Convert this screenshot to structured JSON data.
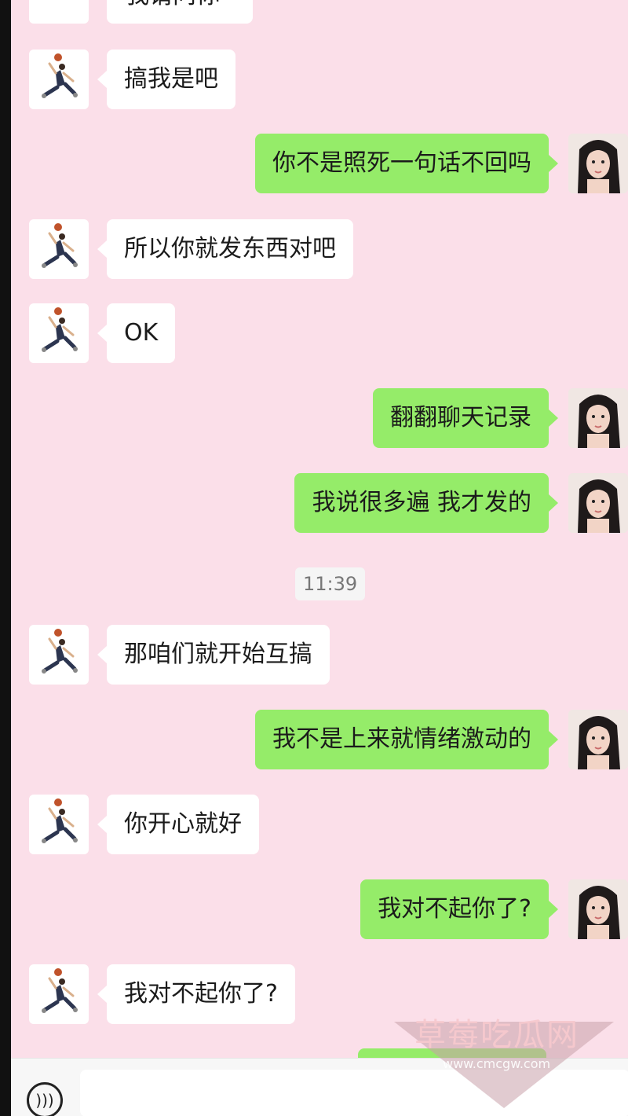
{
  "top_partial_message": "我请问你",
  "messages": [
    {
      "side": "left",
      "text": "搞我是吧"
    },
    {
      "side": "right",
      "text": "你不是照死一句话不回吗"
    },
    {
      "side": "left",
      "text": " 所以你就发东西对吧"
    },
    {
      "side": "left",
      "text": "OK"
    },
    {
      "side": "right",
      "text": "翻翻聊天记录"
    },
    {
      "side": "right",
      "text": "我说很多遍 我才发的"
    },
    {
      "side": "left",
      "text": "那咱们就开始互搞"
    },
    {
      "side": "right",
      "text": "我不是上来就情绪激动的"
    },
    {
      "side": "left",
      "text": "你开心就好"
    },
    {
      "side": "right",
      "text": "我对不起你了?"
    },
    {
      "side": "left",
      "text": "我对不起你了?"
    }
  ],
  "timestamp": "11:39",
  "watermark": {
    "title": "草莓吃瓜网",
    "url": "www.cmcgw.com"
  },
  "input": {
    "placeholder": ""
  },
  "icons": {
    "voice": "voice-icon",
    "left_avatar": "basketball-player-avatar",
    "right_avatar": "woman-portrait-avatar"
  },
  "colors": {
    "background": "#fbdfe9",
    "sent_bubble": "#95ec69",
    "received_bubble": "#ffffff"
  }
}
